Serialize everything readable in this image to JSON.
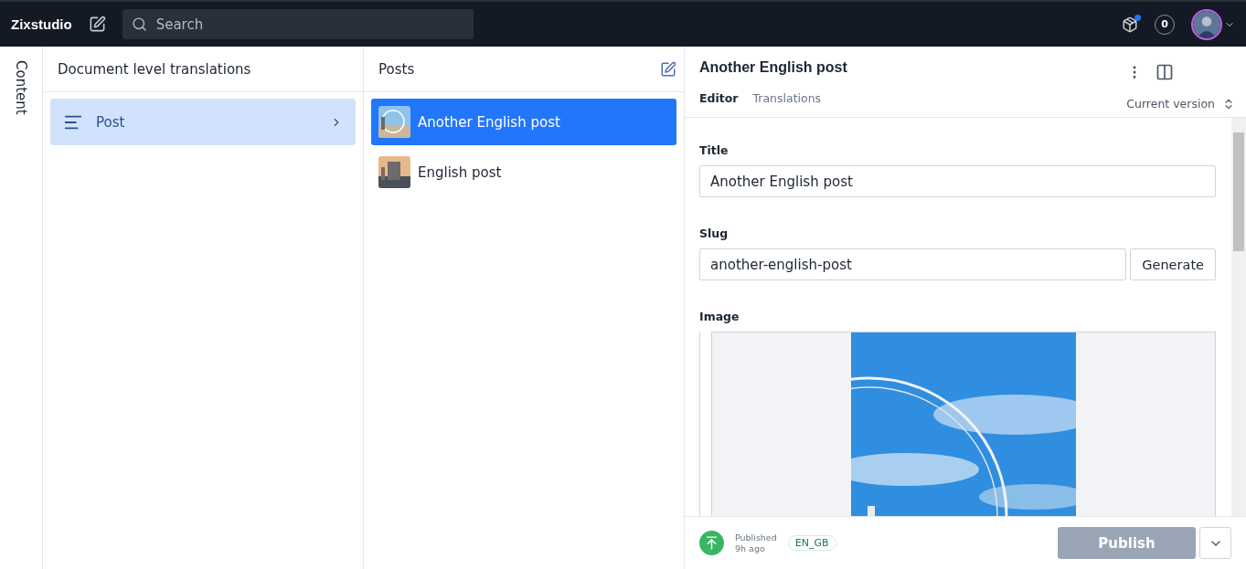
{
  "app": {
    "name": "Zixstudio",
    "search": {
      "placeholder": "Search"
    },
    "notifications": "0"
  },
  "rail": {
    "label": "Content"
  },
  "structure": {
    "title": "Document level translations",
    "items": [
      {
        "label": "Post",
        "selected": true
      }
    ]
  },
  "posts": {
    "title": "Posts",
    "items": [
      {
        "title": "Another English post",
        "selected": true
      },
      {
        "title": "English post",
        "selected": false
      }
    ]
  },
  "document": {
    "title": "Another English post",
    "tabs": [
      {
        "label": "Editor",
        "selected": true
      },
      {
        "label": "Translations",
        "selected": false
      }
    ],
    "version": "Current version",
    "fields": [
      {
        "kind": "text",
        "label": "Title",
        "value": "Another English post"
      },
      {
        "kind": "slug",
        "label": "Slug",
        "value": "another-english-post",
        "action": "Generate"
      },
      {
        "label": "Image"
      }
    ],
    "status": {
      "label": "Published",
      "time": "9h ago"
    },
    "language": "EN_GB",
    "publish": {
      "label": "Publish",
      "disabled": true
    }
  }
}
